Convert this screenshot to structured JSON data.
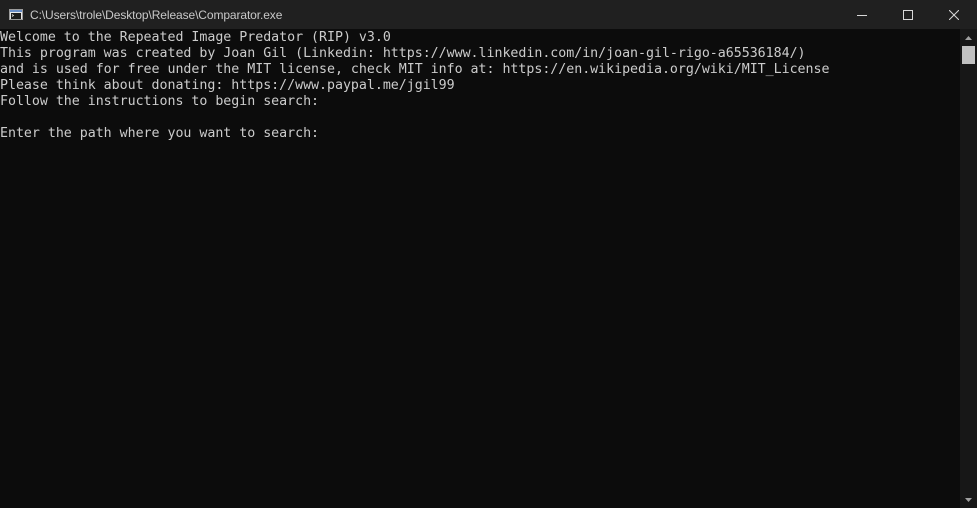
{
  "window": {
    "title": "C:\\Users\\trole\\Desktop\\Release\\Comparator.exe",
    "icons": {
      "app": "console-app-icon",
      "minimize": "minimize-icon",
      "maximize": "maximize-icon",
      "close": "close-icon"
    }
  },
  "console": {
    "lines": [
      "Welcome to the Repeated Image Predator (RIP) v3.0",
      "This program was created by Joan Gil (Linkedin: https://www.linkedin.com/in/joan-gil-rigo-a65536184/)",
      "and is used for free under the MIT license, check MIT info at: https://en.wikipedia.org/wiki/MIT_License",
      "Please think about donating: https://www.paypal.me/jgil99",
      "Follow the instructions to begin search:",
      "",
      "Enter the path where you want to search:"
    ]
  },
  "colors": {
    "console_background": "#0c0c0c",
    "console_text": "#cccccc",
    "titlebar_background": "#202020",
    "title_text": "#c8c8c8"
  }
}
